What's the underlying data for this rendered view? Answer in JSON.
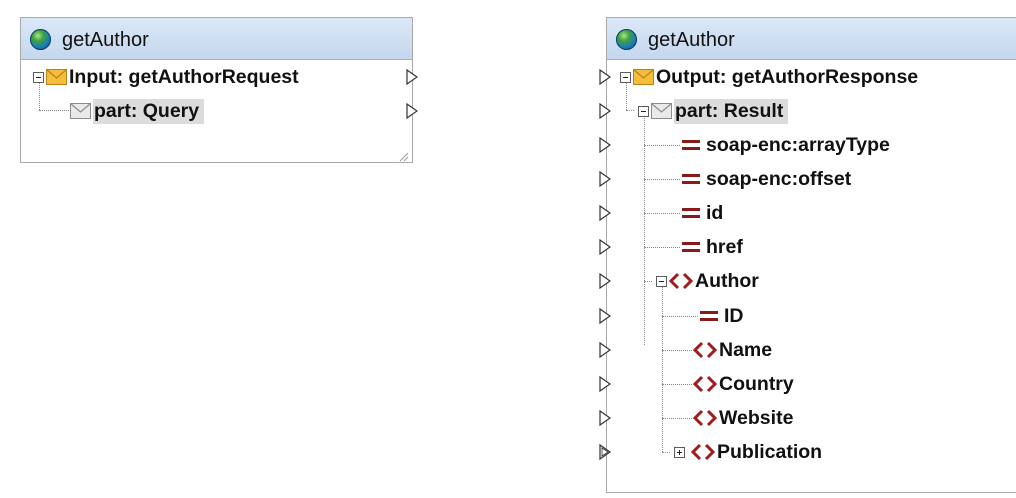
{
  "left_component": {
    "title": "getAuthor",
    "input_label": "Input: getAuthorRequest",
    "part_label": "part: Query"
  },
  "right_component": {
    "title": "getAuthor",
    "output_label": "Output: getAuthorResponse",
    "part_label": "part: Result",
    "attributes": [
      "soap-enc:arrayType",
      "soap-enc:offset",
      "id",
      "href"
    ],
    "author_label": "Author",
    "author_children": [
      {
        "kind": "attribute",
        "label": "ID"
      },
      {
        "kind": "element",
        "label": "Name"
      },
      {
        "kind": "element",
        "label": "Country"
      },
      {
        "kind": "element",
        "label": "Website"
      },
      {
        "kind": "element",
        "label": "Publication",
        "collapsed": true
      }
    ]
  },
  "icon_colors": {
    "envelope_fill": "#f6bc3c",
    "attribute": "#8a1a1a",
    "element": "#a31a1a",
    "globe": "#2d7fc4"
  }
}
